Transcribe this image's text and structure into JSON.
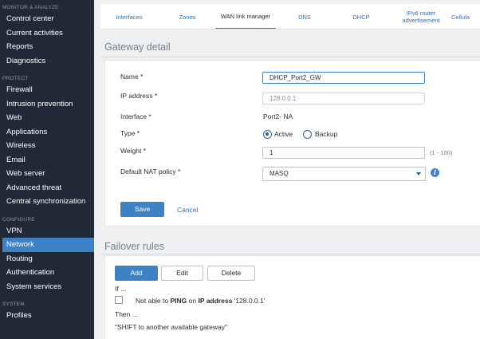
{
  "sidebar": {
    "sections": [
      {
        "header": "MONITOR & ANALYZE",
        "items": [
          "Control center",
          "Current activities",
          "Reports",
          "Diagnostics"
        ]
      },
      {
        "header": "PROTECT",
        "items": [
          "Firewall",
          "Intrusion prevention",
          "Web",
          "Applications",
          "Wireless",
          "Email",
          "Web server",
          "Advanced threat",
          "Central synchronization"
        ]
      },
      {
        "header": "CONFIGURE",
        "items": [
          "VPN",
          "Network",
          "Routing",
          "Authentication",
          "System services"
        ]
      },
      {
        "header": "SYSTEM",
        "items": [
          "Profiles"
        ]
      }
    ],
    "active_item": "Network"
  },
  "tabs": [
    {
      "label": "Interfaces"
    },
    {
      "label": "Zones"
    },
    {
      "label": "WAN link manager"
    },
    {
      "label": "DNS"
    },
    {
      "label": "DHCP"
    },
    {
      "label": "IPv6 router advertisement"
    },
    {
      "label": "Cellula"
    }
  ],
  "active_tab": "WAN link manager",
  "gateway_detail": {
    "title": "Gateway detail",
    "name_label": "Name *",
    "name_value": "DHCP_Port2_GW",
    "ip_label": "IP address *",
    "ip_value": "128.0.0.1",
    "interface_label": "Interface *",
    "interface_value": "Port2- NA",
    "type_label": "Type *",
    "type_active": "Active",
    "type_backup": "Backup",
    "type_selected": "Active",
    "weight_label": "Weight *",
    "weight_value": "1",
    "weight_hint": "(1 - 100)",
    "nat_label": "Default NAT policy *",
    "nat_value": "MASQ",
    "save_label": "Save",
    "cancel_label": "Cancel"
  },
  "failover": {
    "title": "Failover rules",
    "add_label": "Add",
    "edit_label": "Edit",
    "delete_label": "Delete",
    "if_label": "If ...",
    "rule_prefix": "Not able to ",
    "rule_protocol": "PING",
    "rule_middle": " on ",
    "rule_ip_label": "IP address",
    "rule_ip_value": " '128.0.0.1'",
    "then_label": "Then ...",
    "then_action": "\"SHIFT to another available gateway\""
  },
  "colors": {
    "accent": "#3e82c6",
    "sidebar_bg": "#1f2a36",
    "link": "#2a6fb5"
  }
}
